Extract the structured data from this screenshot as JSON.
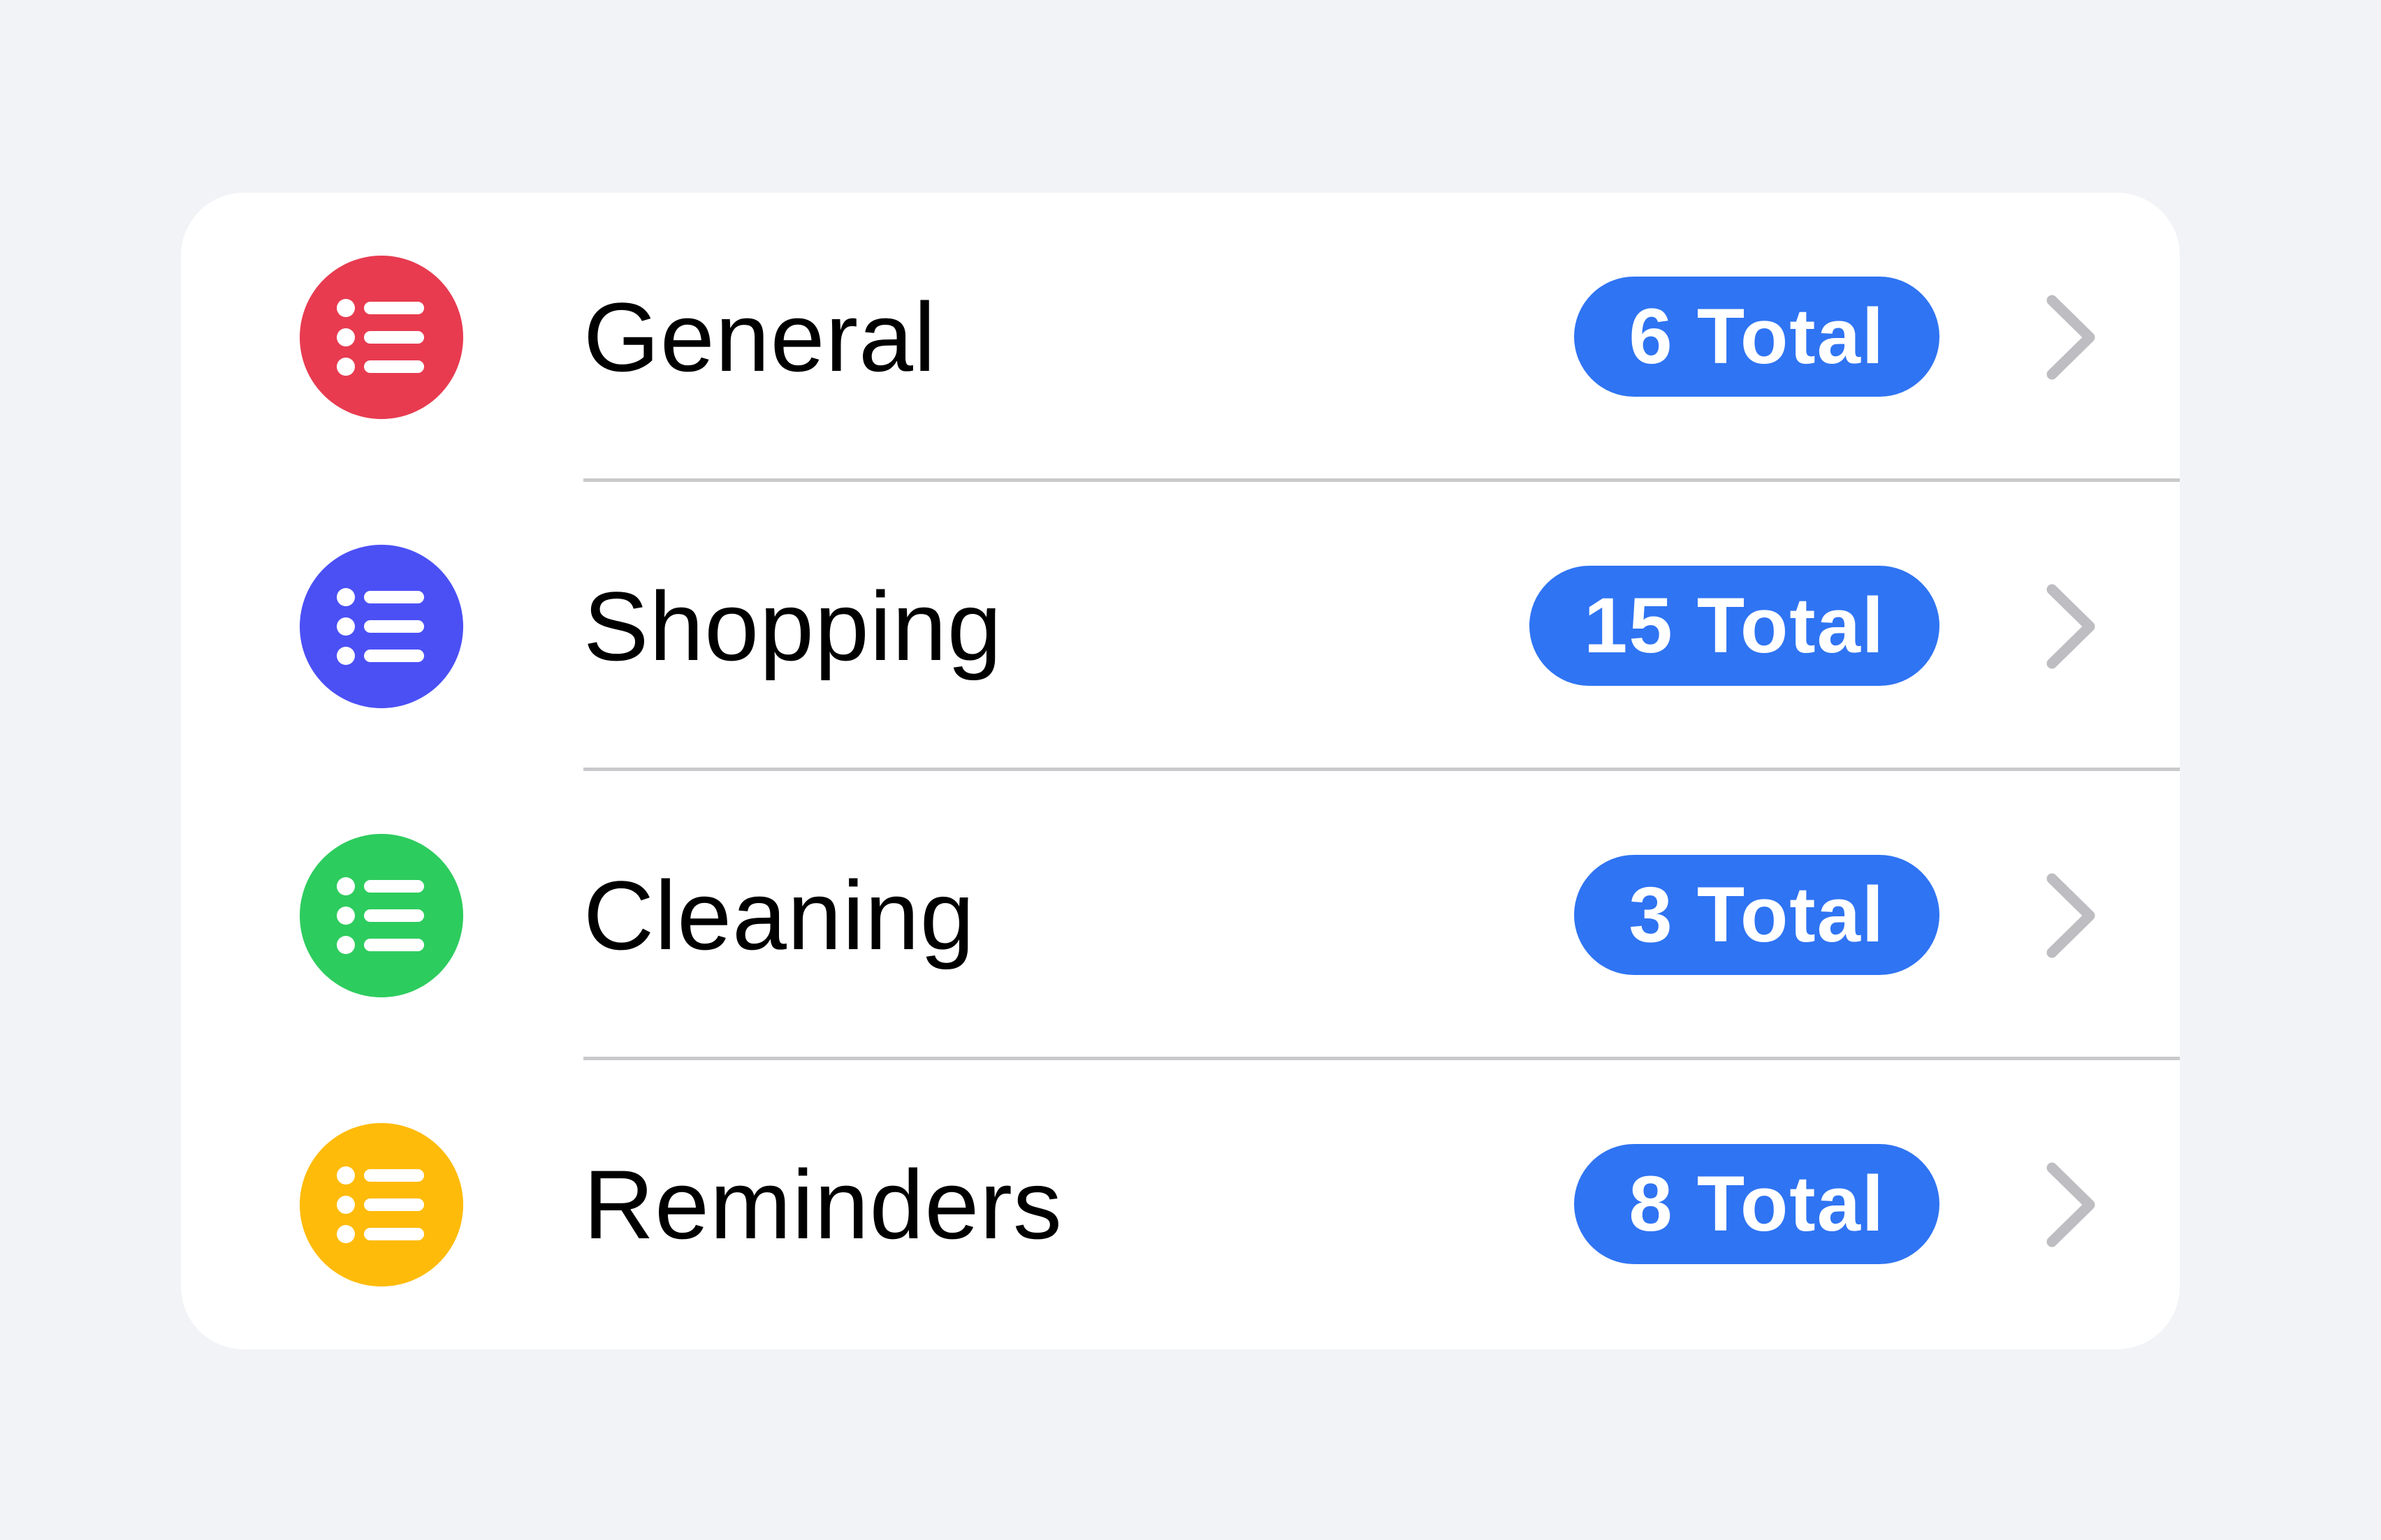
{
  "lists": [
    {
      "name": "General",
      "badge": "6 Total",
      "icon": "list-bullet-icon",
      "color": "#e83b50"
    },
    {
      "name": "Shopping",
      "badge": "15 Total",
      "icon": "list-bullet-icon",
      "color": "#4b50f5"
    },
    {
      "name": "Cleaning",
      "badge": "3 Total",
      "icon": "list-bullet-icon",
      "color": "#2dcc5e"
    },
    {
      "name": "Reminders",
      "badge": "8 Total",
      "icon": "list-bullet-icon",
      "color": "#ffbb0a"
    }
  ],
  "badge_color": "#2f74f3",
  "chevron_color": "#bdbdc2",
  "background_color": "#f2f3f7"
}
